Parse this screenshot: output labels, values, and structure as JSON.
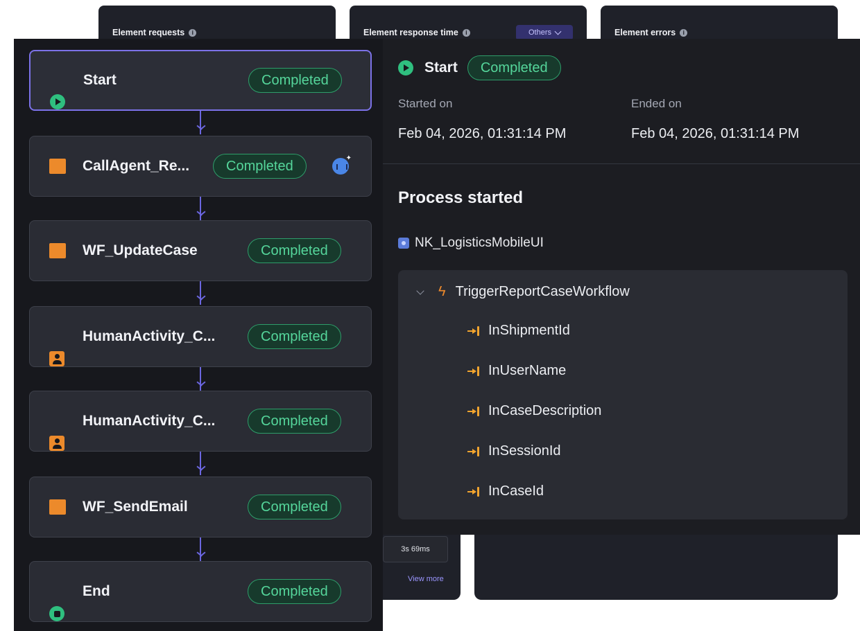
{
  "dashboard": {
    "cards": [
      {
        "title": "Element requests"
      },
      {
        "title": "Element response time",
        "filter": "Others"
      },
      {
        "title": "Element errors"
      }
    ],
    "duration_chip": "3s 69ms",
    "view_more": "View more"
  },
  "flow": {
    "nodes": [
      {
        "label": "Start",
        "status": "Completed",
        "icon": "start-circle-icon"
      },
      {
        "label": "CallAgent_Re...",
        "status": "Completed",
        "icon": "task-square-icon",
        "badge": "agent-icon"
      },
      {
        "label": "WF_UpdateCase",
        "status": "Completed",
        "icon": "task-square-icon"
      },
      {
        "label": "HumanActivity_C...",
        "status": "Completed",
        "icon": "person-icon"
      },
      {
        "label": "HumanActivity_C...",
        "status": "Completed",
        "icon": "person-icon"
      },
      {
        "label": "WF_SendEmail",
        "status": "Completed",
        "icon": "task-square-icon"
      },
      {
        "label": "End",
        "status": "Completed",
        "icon": "end-circle-icon"
      }
    ]
  },
  "details": {
    "title": "Start",
    "status": "Completed",
    "started_label": "Started on",
    "started_value": "Feb 04, 2026, 01:31:14 PM",
    "ended_label": "Ended on",
    "ended_value": "Feb 04, 2026, 01:31:14 PM",
    "section_title": "Process started",
    "app_name": "NK_LogisticsMobileUI",
    "trigger": {
      "name": "TriggerReportCaseWorkflow",
      "arguments": [
        "InShipmentId",
        "InUserName",
        "InCaseDescription",
        "InSessionId",
        "InCaseId"
      ]
    }
  },
  "colors": {
    "accent": "#7c72e8",
    "success": "#55d69b",
    "task_orange": "#ec8a2b"
  }
}
